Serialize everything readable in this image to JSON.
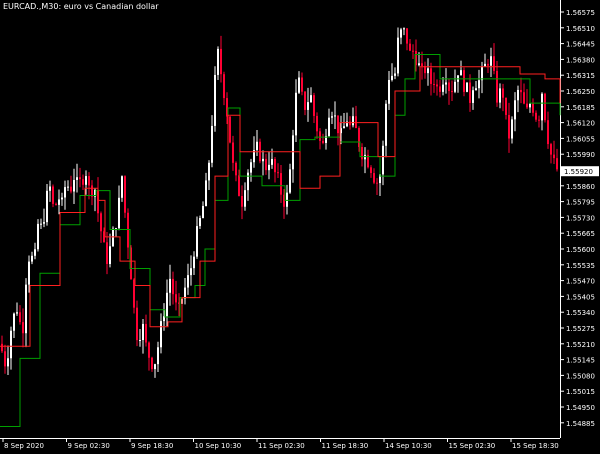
{
  "window": {
    "symbol": "EURCAD.,M30",
    "description": "euro vs Canadian dollar"
  },
  "colors": {
    "background": "#000000",
    "axis": "#ffffff",
    "candle_up": "#ffffff",
    "candle_down": "#ff0033",
    "signal_line": "#ff2020",
    "trail_line": "#00a000"
  },
  "chart_data": {
    "type": "candlestick",
    "title": "EURCAD.,M30:  euro vs Canadian dollar",
    "y_ticks": [
      "1.56575",
      "1.56510",
      "1.56445",
      "1.56380",
      "1.56315",
      "1.56250",
      "1.56185",
      "1.56120",
      "1.56055",
      "1.55990",
      "1.55925",
      "1.55860",
      "1.55795",
      "1.55730",
      "1.55665",
      "1.55600",
      "1.55535",
      "1.55470",
      "1.55405",
      "1.55340",
      "1.55275",
      "1.55210",
      "1.55145",
      "1.55080",
      "1.55015",
      "1.54950",
      "1.54885"
    ],
    "x_ticks": [
      "8 Sep 2020",
      "9 Sep 02:30",
      "9 Sep 18:30",
      "10 Sep 10:30",
      "11 Sep 02:30",
      "11 Sep 18:30",
      "14 Sep 10:30",
      "15 Sep 02:30",
      "15 Sep 18:30"
    ],
    "ylim": [
      1.5487,
      1.566
    ],
    "close_path": [
      [
        0,
        1.5521
      ],
      [
        6,
        1.5512
      ],
      [
        12,
        1.553
      ],
      [
        18,
        1.5537
      ],
      [
        22,
        1.5522
      ],
      [
        26,
        1.5548
      ],
      [
        30,
        1.556
      ],
      [
        34,
        1.5552
      ],
      [
        38,
        1.557
      ],
      [
        42,
        1.5568
      ],
      [
        46,
        1.558
      ],
      [
        50,
        1.5585
      ],
      [
        54,
        1.5575
      ],
      [
        58,
        1.5582
      ],
      [
        62,
        1.5578
      ],
      [
        66,
        1.5588
      ],
      [
        70,
        1.5584
      ],
      [
        74,
        1.559
      ],
      [
        78,
        1.5585
      ],
      [
        82,
        1.5589
      ],
      [
        86,
        1.5592
      ],
      [
        90,
        1.5582
      ],
      [
        94,
        1.5588
      ],
      [
        98,
        1.5575
      ],
      [
        102,
        1.5565
      ],
      [
        106,
        1.5555
      ],
      [
        110,
        1.556
      ],
      [
        114,
        1.5568
      ],
      [
        118,
        1.5575
      ],
      [
        122,
        1.559
      ],
      [
        126,
        1.557
      ],
      [
        130,
        1.5555
      ],
      [
        134,
        1.5535
      ],
      [
        138,
        1.5522
      ],
      [
        142,
        1.553
      ],
      [
        146,
        1.552
      ],
      [
        150,
        1.5515
      ],
      [
        154,
        1.5512
      ],
      [
        158,
        1.552
      ],
      [
        162,
        1.553
      ],
      [
        166,
        1.554
      ],
      [
        170,
        1.5548
      ],
      [
        174,
        1.554
      ],
      [
        178,
        1.5532
      ],
      [
        182,
        1.554
      ],
      [
        186,
        1.5545
      ],
      [
        190,
        1.555
      ],
      [
        194,
        1.556
      ],
      [
        198,
        1.5568
      ],
      [
        202,
        1.5575
      ],
      [
        206,
        1.5585
      ],
      [
        210,
        1.56
      ],
      [
        214,
        1.5625
      ],
      [
        218,
        1.564
      ],
      [
        222,
        1.563
      ],
      [
        226,
        1.562
      ],
      [
        230,
        1.5605
      ],
      [
        234,
        1.559
      ],
      [
        238,
        1.5585
      ],
      [
        242,
        1.558
      ],
      [
        246,
        1.559
      ],
      [
        250,
        1.5595
      ],
      [
        254,
        1.5598
      ],
      [
        258,
        1.5602
      ],
      [
        262,
        1.5596
      ],
      [
        266,
        1.5594
      ],
      [
        270,
        1.5598
      ],
      [
        274,
        1.5592
      ],
      [
        278,
        1.5588
      ],
      [
        282,
        1.5582
      ],
      [
        286,
        1.5578
      ],
      [
        290,
        1.5592
      ],
      [
        294,
        1.5615
      ],
      [
        298,
        1.563
      ],
      [
        302,
        1.5622
      ],
      [
        306,
        1.5618
      ],
      [
        310,
        1.5625
      ],
      [
        314,
        1.5615
      ],
      [
        318,
        1.5608
      ],
      [
        322,
        1.56
      ],
      [
        326,
        1.561
      ],
      [
        330,
        1.562
      ],
      [
        334,
        1.5615
      ],
      [
        338,
        1.561
      ],
      [
        342,
        1.5605
      ],
      [
        346,
        1.5615
      ],
      [
        350,
        1.561
      ],
      [
        354,
        1.5612
      ],
      [
        358,
        1.5605
      ],
      [
        362,
        1.56
      ],
      [
        366,
        1.5598
      ],
      [
        370,
        1.5595
      ],
      [
        374,
        1.559
      ],
      [
        378,
        1.5587
      ],
      [
        382,
        1.5595
      ],
      [
        386,
        1.562
      ],
      [
        390,
        1.5635
      ],
      [
        394,
        1.5628
      ],
      [
        398,
        1.5645
      ],
      [
        402,
        1.565
      ],
      [
        406,
        1.5648
      ],
      [
        410,
        1.564
      ],
      [
        414,
        1.5642
      ],
      [
        418,
        1.5636
      ],
      [
        422,
        1.5632
      ],
      [
        426,
        1.5635
      ],
      [
        430,
        1.5628
      ],
      [
        434,
        1.563
      ],
      [
        438,
        1.5625
      ],
      [
        442,
        1.563
      ],
      [
        446,
        1.5632
      ],
      [
        450,
        1.5625
      ],
      [
        454,
        1.5628
      ],
      [
        458,
        1.5634
      ],
      [
        462,
        1.563
      ],
      [
        466,
        1.5626
      ],
      [
        470,
        1.5622
      ],
      [
        474,
        1.563
      ],
      [
        478,
        1.5628
      ],
      [
        482,
        1.5632
      ],
      [
        486,
        1.5636
      ],
      [
        490,
        1.564
      ],
      [
        494,
        1.563
      ],
      [
        498,
        1.562
      ],
      [
        502,
        1.5628
      ],
      [
        506,
        1.5612
      ],
      [
        510,
        1.5605
      ],
      [
        514,
        1.5618
      ],
      [
        518,
        1.5625
      ],
      [
        522,
        1.5622
      ],
      [
        526,
        1.5615
      ],
      [
        530,
        1.562
      ],
      [
        534,
        1.5618
      ],
      [
        538,
        1.5612
      ],
      [
        542,
        1.5625
      ],
      [
        546,
        1.5612
      ],
      [
        550,
        1.56
      ],
      [
        554,
        1.5595
      ],
      [
        558,
        1.5592
      ]
    ],
    "signal_line": [
      [
        0,
        1.552
      ],
      [
        30,
        1.5545
      ],
      [
        60,
        1.5575
      ],
      [
        85,
        1.5585
      ],
      [
        98,
        1.558
      ],
      [
        105,
        1.5565
      ],
      [
        120,
        1.5555
      ],
      [
        135,
        1.5545
      ],
      [
        150,
        1.5528
      ],
      [
        168,
        1.553
      ],
      [
        182,
        1.554
      ],
      [
        200,
        1.5555
      ],
      [
        215,
        1.559
      ],
      [
        228,
        1.5615
      ],
      [
        240,
        1.56
      ],
      [
        260,
        1.56
      ],
      [
        280,
        1.56
      ],
      [
        300,
        1.5585
      ],
      [
        320,
        1.559
      ],
      [
        340,
        1.5612
      ],
      [
        360,
        1.5612
      ],
      [
        378,
        1.5598
      ],
      [
        395,
        1.5625
      ],
      [
        420,
        1.5635
      ],
      [
        460,
        1.5635
      ],
      [
        490,
        1.5635
      ],
      [
        520,
        1.5632
      ],
      [
        545,
        1.563
      ],
      [
        560,
        1.562
      ]
    ],
    "trail_line": [
      [
        0,
        1.5487
      ],
      [
        20,
        1.5515
      ],
      [
        40,
        1.555
      ],
      [
        60,
        1.557
      ],
      [
        80,
        1.5582
      ],
      [
        96,
        1.5584
      ],
      [
        110,
        1.5568
      ],
      [
        130,
        1.5552
      ],
      [
        150,
        1.5535
      ],
      [
        165,
        1.5532
      ],
      [
        180,
        1.554
      ],
      [
        195,
        1.5545
      ],
      [
        205,
        1.556
      ],
      [
        215,
        1.558
      ],
      [
        228,
        1.5618
      ],
      [
        240,
        1.559
      ],
      [
        262,
        1.5586
      ],
      [
        285,
        1.558
      ],
      [
        300,
        1.5605
      ],
      [
        315,
        1.5606
      ],
      [
        340,
        1.5604
      ],
      [
        360,
        1.5598
      ],
      [
        380,
        1.559
      ],
      [
        395,
        1.5615
      ],
      [
        405,
        1.563
      ],
      [
        415,
        1.564
      ],
      [
        440,
        1.563
      ],
      [
        470,
        1.563
      ],
      [
        500,
        1.563
      ],
      [
        530,
        1.562
      ],
      [
        560,
        1.5615
      ]
    ]
  }
}
